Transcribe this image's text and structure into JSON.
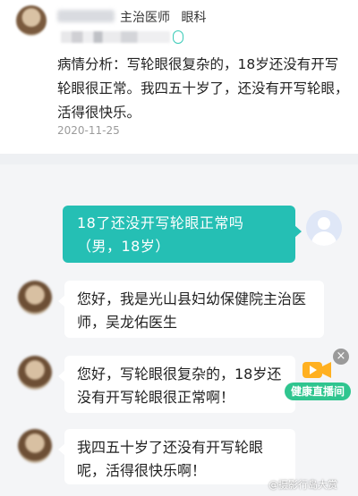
{
  "header": {
    "doctor_title": "主治医师",
    "department": "眼科",
    "analysis_text": "病情分析：写轮眼很复杂的，18岁还没有开写轮眼很正常。我四五十岁了，还没有开写轮眼，活得很快乐。",
    "date": "2020-11-25"
  },
  "chat": {
    "user_question": "18了还没开写轮眼正常吗（男，18岁）",
    "doctor_messages": [
      "您好，我是光山县妇幼保健院主治医师，吴龙佑医生",
      "您好，写轮眼很复杂的，18岁还没有开写轮眼很正常啊！",
      "我四五十岁了还没有开写轮眼呢，活得很快乐啊！"
    ]
  },
  "live_widget": {
    "label": "健康直播间",
    "close_symbol": "×"
  },
  "watermark": "@摄影行岛大赏",
  "icons": {
    "close": "close-icon",
    "video": "video-camera-icon"
  },
  "colors": {
    "accent": "#25bfb4",
    "live": "#2fc58f"
  }
}
